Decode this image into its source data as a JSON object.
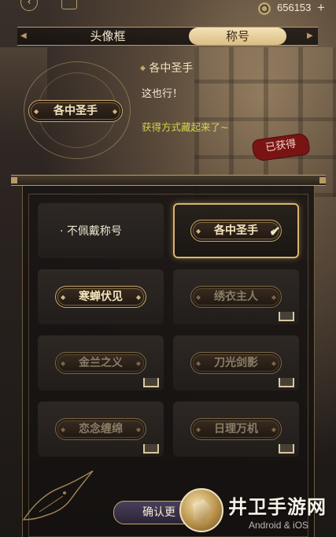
{
  "topbar": {
    "currency_amount": "656153",
    "plus_label": "+",
    "back_icon": "back-arrow-icon",
    "home_icon": "home-icon",
    "coin_icon": "coin-icon"
  },
  "tabs": [
    {
      "label": "头像框",
      "active": false
    },
    {
      "label": "称号",
      "active": true
    }
  ],
  "preview": {
    "title_plaque": "各中圣手",
    "title_name": "各中圣手",
    "description": "这也行！",
    "source": "获得方式藏起来了~",
    "obtained_seal": "已获得"
  },
  "titles": [
    {
      "label": "· 不佩戴称号",
      "style": "plain"
    },
    {
      "label": "各中圣手",
      "style": "selected",
      "checked": true
    },
    {
      "label": "寒蝉伏见",
      "style": "owned"
    },
    {
      "label": "绣衣主人",
      "style": "locked"
    },
    {
      "label": "金兰之义",
      "style": "locked"
    },
    {
      "label": "刀光剑影",
      "style": "locked"
    },
    {
      "label": "恋念缠绵",
      "style": "locked"
    },
    {
      "label": "日理万机",
      "style": "locked"
    }
  ],
  "confirm_label": "确认更",
  "watermark": {
    "text": "井卫手游网",
    "sub": "Android & iOS"
  },
  "colors": {
    "gold": "#c7a56a",
    "source_text": "#d8d24a",
    "seal": "#7a1414"
  }
}
